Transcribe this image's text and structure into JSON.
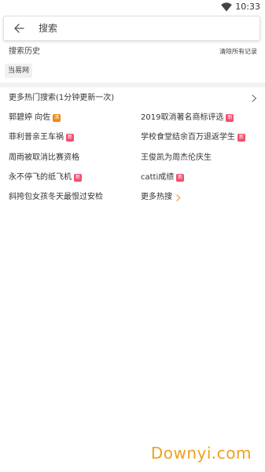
{
  "status_bar": {
    "time": "10:33",
    "wifi_icon": "wifi-icon"
  },
  "search": {
    "placeholder": "搜索",
    "value": "",
    "back_icon": "arrow-left-icon"
  },
  "history": {
    "title": "搜索历史",
    "clear_label": "清除所有记录",
    "tags": [
      "当易网"
    ]
  },
  "hot": {
    "header_label": "更多热门搜索(1分钟更新一次)",
    "items": [
      {
        "text": "郭碧婷 向佐",
        "badge": "沸",
        "badge_type": "hot"
      },
      {
        "text": "2019取消著名商标评选",
        "badge": "新",
        "badge_type": "new"
      },
      {
        "text": "菲利普亲王车祸",
        "badge": "新",
        "badge_type": "new"
      },
      {
        "text": "学校食堂结余百万退返学生",
        "badge": "新",
        "badge_type": "new"
      },
      {
        "text": "周雨被取消比赛资格",
        "badge": "",
        "badge_type": ""
      },
      {
        "text": "王俊凯为周杰伦庆生",
        "badge": "",
        "badge_type": ""
      },
      {
        "text": "永不停飞的纸飞机",
        "badge": "新",
        "badge_type": "new"
      },
      {
        "text": "catti成绩",
        "badge": "新",
        "badge_type": "new"
      },
      {
        "text": "斜挎包女孩冬天最恨过安检",
        "badge": "",
        "badge_type": ""
      },
      {
        "text": "更多热搜",
        "badge": "",
        "badge_type": ""
      }
    ]
  },
  "colors": {
    "badge_hot": "#f08a18",
    "badge_new": "#f2506e",
    "more_chevron": "#f0a020",
    "watermark": "#f0a020"
  },
  "watermark": "Downyi.com"
}
